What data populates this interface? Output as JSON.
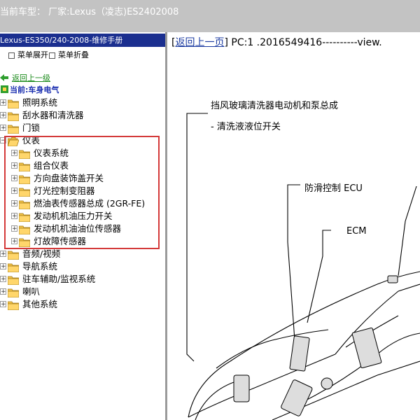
{
  "window": {
    "title": "当前车型： 厂家:Lexus（凌志)ES2402008"
  },
  "sidebar": {
    "header": "Lexus-ES350/240-2008-维修手册",
    "expand_all": "菜单展开",
    "collapse_all": "菜单折叠",
    "back_label": "返回上一级",
    "current_label": "当前:车身电气",
    "items": [
      {
        "label": "照明系统",
        "expanded": false,
        "level": 0
      },
      {
        "label": "刮水器和清洗器",
        "expanded": false,
        "level": 0
      },
      {
        "label": "门锁",
        "expanded": false,
        "level": 0
      },
      {
        "label": "仪表",
        "expanded": true,
        "level": 0
      },
      {
        "label": "仪表系统",
        "expanded": false,
        "level": 1
      },
      {
        "label": "组合仪表",
        "expanded": false,
        "level": 1
      },
      {
        "label": "方向盘装饰盖开关",
        "expanded": false,
        "level": 1
      },
      {
        "label": "灯光控制变阻器",
        "expanded": false,
        "level": 1
      },
      {
        "label": "燃油表传感器总成 (2GR-FE)",
        "expanded": false,
        "level": 1
      },
      {
        "label": "发动机机油压力开关",
        "expanded": false,
        "level": 1
      },
      {
        "label": "发动机机油油位传感器",
        "expanded": false,
        "level": 1
      },
      {
        "label": "灯故障传感器",
        "expanded": false,
        "level": 1
      },
      {
        "label": "音频/视频",
        "expanded": false,
        "level": 0
      },
      {
        "label": "导航系统",
        "expanded": false,
        "level": 0
      },
      {
        "label": "驻车辅助/监视系统",
        "expanded": false,
        "level": 0
      },
      {
        "label": "喇叭",
        "expanded": false,
        "level": 0
      },
      {
        "label": "其他系统",
        "expanded": false,
        "level": 0
      }
    ]
  },
  "main": {
    "back_link": "返回上一页",
    "page_info": "PC:1 .2016549416----------view.",
    "callouts": {
      "washer_motor": "挡风玻璃清洗器电动机和泵总成",
      "washer_level": "- 清洗液液位开关",
      "skid_ecu": "防滑控制 ECU",
      "ecm": "ECM"
    }
  },
  "colors": {
    "header_bg": "#1b2f8f",
    "highlight_border": "#d43a3a",
    "link": "#1a3aa0",
    "back_link": "#1a8a1a"
  }
}
